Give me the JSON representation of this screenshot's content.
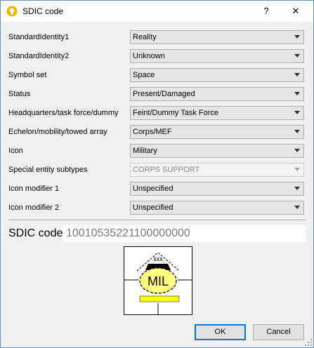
{
  "window": {
    "title": "SDIC code",
    "help": "?",
    "close": "✕",
    "icon": "app-lightbulb-icon"
  },
  "fields": [
    {
      "label": "StandardIdentity1",
      "value": "Reality",
      "enabled": true
    },
    {
      "label": "StandardIdentity2",
      "value": "Unknown",
      "enabled": true
    },
    {
      "label": "Symbol set",
      "value": "Space",
      "enabled": true
    },
    {
      "label": "Status",
      "value": "Present/Damaged",
      "enabled": true
    },
    {
      "label": "Headquarters/task force/dummy",
      "value": "Feint/Dummy Task Force",
      "enabled": true
    },
    {
      "label": "Echelon/mobility/towed array",
      "value": "Corps/MEF",
      "enabled": true
    },
    {
      "label": "Icon",
      "value": "Military",
      "enabled": true
    },
    {
      "label": "Special entity subtypes",
      "value": "CORPS SUPPORT",
      "enabled": false
    },
    {
      "label": "Icon modifier 1",
      "value": "Unspecified",
      "enabled": true
    },
    {
      "label": "Icon modifier 2",
      "value": "Unspecified",
      "enabled": true
    }
  ],
  "sdic": {
    "label": "SDIC code",
    "value": "10010535221100000000"
  },
  "symbol": {
    "text": "MIL",
    "echelon": "xxx",
    "fill": "#ffff80",
    "damage_bar": "#ffff00"
  },
  "buttons": {
    "ok": "OK",
    "cancel": "Cancel"
  }
}
